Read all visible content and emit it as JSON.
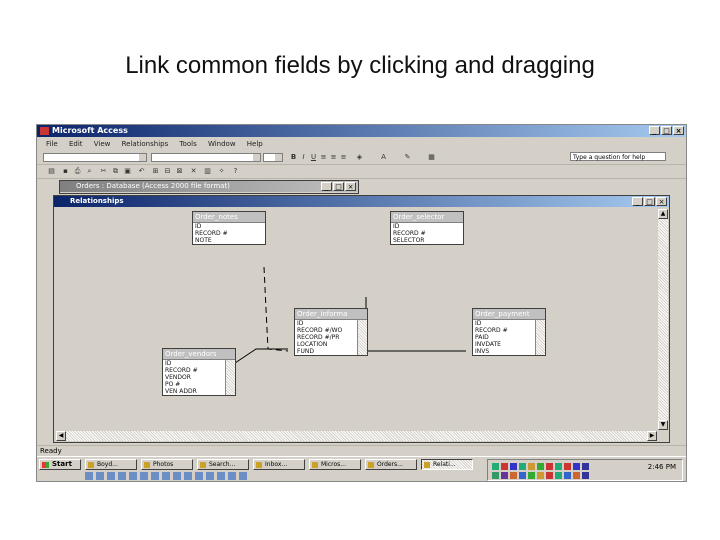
{
  "slide": {
    "title": "Link common fields by clicking and dragging"
  },
  "window": {
    "title": "Microsoft Access"
  },
  "menu": {
    "items": [
      "File",
      "Edit",
      "View",
      "Relationships",
      "Tools",
      "Window",
      "Help"
    ],
    "ask_placeholder": "Type a question for help"
  },
  "db_window": {
    "title": "Orders : Database (Access 2000 file format)"
  },
  "relationships_window": {
    "title": "Relationships"
  },
  "tables": [
    {
      "name": "Order_notes",
      "fields": [
        "ID",
        "RECORD #",
        "NOTE"
      ]
    },
    {
      "name": "Order_selector",
      "fields": [
        "ID",
        "RECORD #",
        "SELECTOR"
      ]
    },
    {
      "name": "Order_informa",
      "fields": [
        "ID",
        "RECORD #/WO",
        "RECORD #/PR",
        "LOCATION",
        "FUND"
      ]
    },
    {
      "name": "Order_payment",
      "fields": [
        "ID",
        "RECORD #",
        "PAID",
        "INVDATE",
        "INVS"
      ]
    },
    {
      "name": "Order_vendors",
      "fields": [
        "ID",
        "RECORD #",
        "VENDOR",
        "PO #",
        "VEN ADDR"
      ]
    }
  ],
  "status": {
    "text": "Ready"
  },
  "taskbar": {
    "start_label": "Start",
    "tasks": [
      "Boyd...",
      "Photos",
      "Search...",
      "Inbox...",
      "Micros...",
      "Orders...",
      "Relati..."
    ],
    "clock": "2:46 PM"
  },
  "colors": {
    "titlebar": "#0a246a",
    "face": "#d4d0c8",
    "link_line": "#000000"
  }
}
